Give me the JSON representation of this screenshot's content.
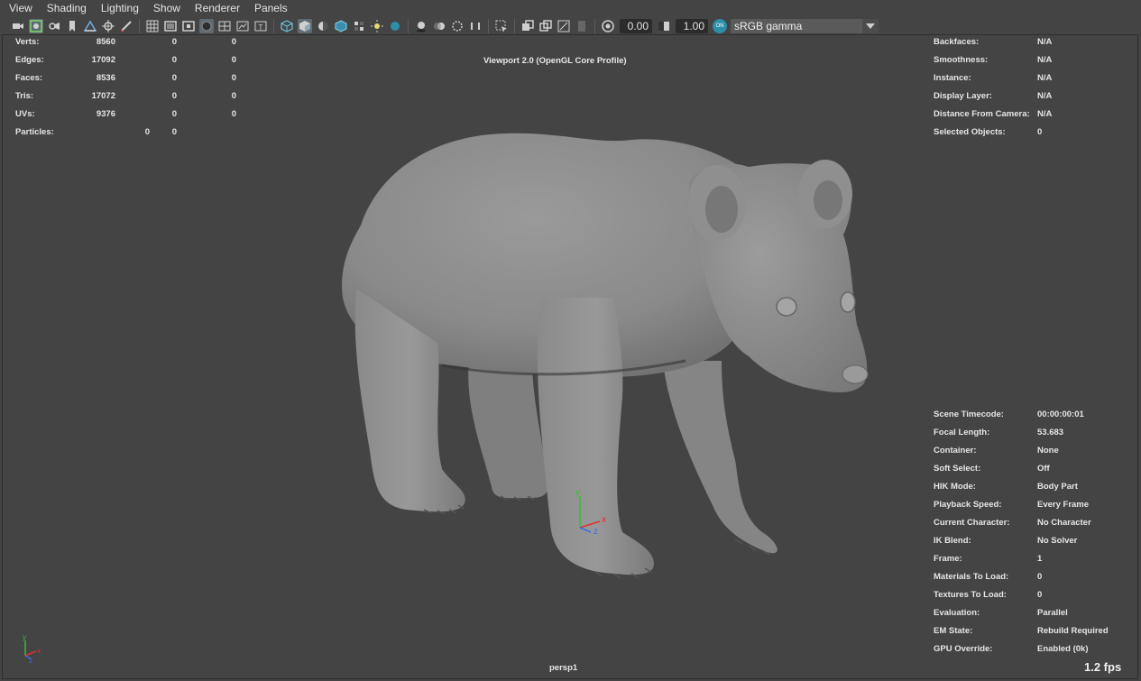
{
  "menu": [
    "View",
    "Shading",
    "Lighting",
    "Show",
    "Renderer",
    "Panels"
  ],
  "toolbar": {
    "exposure": "0.00",
    "gamma": "1.00",
    "color_management_badge": "ON",
    "color_space": "sRGB gamma"
  },
  "viewport": {
    "renderer": "Viewport 2.0 (OpenGL Core Profile)",
    "camera": "persp1",
    "fps": "1.2 fps"
  },
  "poly_count": [
    {
      "label": "Verts:",
      "v1": "8560",
      "v2": "0",
      "v3": "0"
    },
    {
      "label": "Edges:",
      "v1": "17092",
      "v2": "0",
      "v3": "0"
    },
    {
      "label": "Faces:",
      "v1": "8536",
      "v2": "0",
      "v3": "0"
    },
    {
      "label": "Tris:",
      "v1": "17072",
      "v2": "0",
      "v3": "0"
    },
    {
      "label": "UVs:",
      "v1": "9376",
      "v2": "0",
      "v3": "0"
    },
    {
      "label": "Particles:",
      "v1": "0",
      "v2": "0",
      "v3": ""
    }
  ],
  "object_details": [
    {
      "label": "Backfaces:",
      "value": "N/A"
    },
    {
      "label": "Smoothness:",
      "value": "N/A"
    },
    {
      "label": "Instance:",
      "value": "N/A"
    },
    {
      "label": "Display Layer:",
      "value": "N/A"
    },
    {
      "label": "Distance From Camera:",
      "value": "N/A"
    },
    {
      "label": "Selected Objects:",
      "value": "0"
    }
  ],
  "scene_info": [
    {
      "label": "Scene Timecode:",
      "value": "00:00:00:01"
    },
    {
      "label": "Focal Length:",
      "value": "53.683"
    },
    {
      "label": "Container:",
      "value": "None"
    },
    {
      "label": "Soft Select:",
      "value": "Off"
    },
    {
      "label": "HIK Mode:",
      "value": "Body Part"
    },
    {
      "label": "Playback Speed:",
      "value": "Every Frame"
    },
    {
      "label": "Current Character:",
      "value": "No Character"
    },
    {
      "label": "IK Blend:",
      "value": "No Solver"
    },
    {
      "label": "Frame:",
      "value": "1"
    },
    {
      "label": "Materials To Load:",
      "value": "0"
    },
    {
      "label": "Textures To Load:",
      "value": "0"
    },
    {
      "label": "Evaluation:",
      "value": "Parallel"
    },
    {
      "label": "EM State:",
      "value": "Rebuild Required"
    },
    {
      "label": "GPU Override:",
      "value": "Enabled (0k)"
    }
  ],
  "axis_labels": {
    "x": "x",
    "y": "y",
    "z": "z"
  },
  "colors": {
    "background": "#444444",
    "model": "#8a8a8a",
    "accent": "#2e8ea8",
    "axis_x": "#e03030",
    "axis_y": "#30c030",
    "axis_z": "#3a6ee0"
  }
}
